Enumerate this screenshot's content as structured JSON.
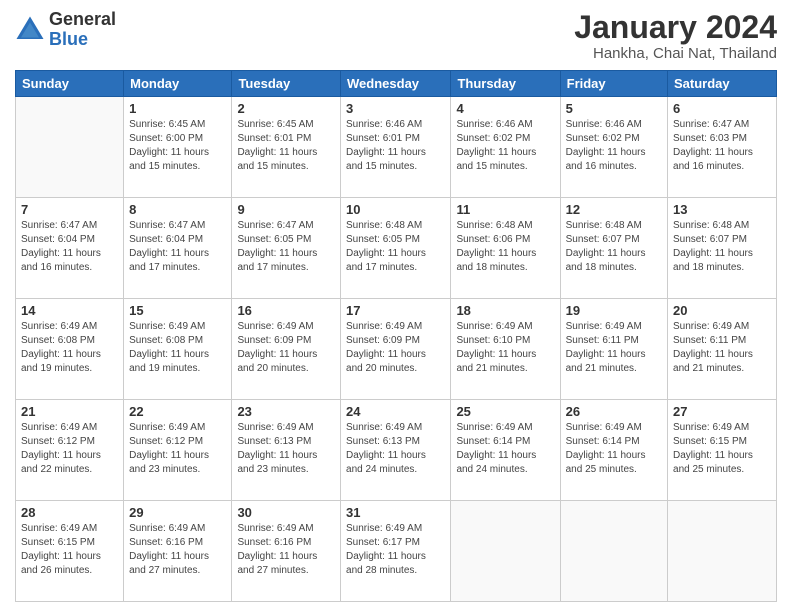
{
  "logo": {
    "general": "General",
    "blue": "Blue"
  },
  "header": {
    "title": "January 2024",
    "subtitle": "Hankha, Chai Nat, Thailand"
  },
  "days_of_week": [
    "Sunday",
    "Monday",
    "Tuesday",
    "Wednesday",
    "Thursday",
    "Friday",
    "Saturday"
  ],
  "weeks": [
    [
      {
        "day": "",
        "info": ""
      },
      {
        "day": "1",
        "info": "Sunrise: 6:45 AM\nSunset: 6:00 PM\nDaylight: 11 hours\nand 15 minutes."
      },
      {
        "day": "2",
        "info": "Sunrise: 6:45 AM\nSunset: 6:01 PM\nDaylight: 11 hours\nand 15 minutes."
      },
      {
        "day": "3",
        "info": "Sunrise: 6:46 AM\nSunset: 6:01 PM\nDaylight: 11 hours\nand 15 minutes."
      },
      {
        "day": "4",
        "info": "Sunrise: 6:46 AM\nSunset: 6:02 PM\nDaylight: 11 hours\nand 15 minutes."
      },
      {
        "day": "5",
        "info": "Sunrise: 6:46 AM\nSunset: 6:02 PM\nDaylight: 11 hours\nand 16 minutes."
      },
      {
        "day": "6",
        "info": "Sunrise: 6:47 AM\nSunset: 6:03 PM\nDaylight: 11 hours\nand 16 minutes."
      }
    ],
    [
      {
        "day": "7",
        "info": "Sunrise: 6:47 AM\nSunset: 6:04 PM\nDaylight: 11 hours\nand 16 minutes."
      },
      {
        "day": "8",
        "info": "Sunrise: 6:47 AM\nSunset: 6:04 PM\nDaylight: 11 hours\nand 17 minutes."
      },
      {
        "day": "9",
        "info": "Sunrise: 6:47 AM\nSunset: 6:05 PM\nDaylight: 11 hours\nand 17 minutes."
      },
      {
        "day": "10",
        "info": "Sunrise: 6:48 AM\nSunset: 6:05 PM\nDaylight: 11 hours\nand 17 minutes."
      },
      {
        "day": "11",
        "info": "Sunrise: 6:48 AM\nSunset: 6:06 PM\nDaylight: 11 hours\nand 18 minutes."
      },
      {
        "day": "12",
        "info": "Sunrise: 6:48 AM\nSunset: 6:07 PM\nDaylight: 11 hours\nand 18 minutes."
      },
      {
        "day": "13",
        "info": "Sunrise: 6:48 AM\nSunset: 6:07 PM\nDaylight: 11 hours\nand 18 minutes."
      }
    ],
    [
      {
        "day": "14",
        "info": "Sunrise: 6:49 AM\nSunset: 6:08 PM\nDaylight: 11 hours\nand 19 minutes."
      },
      {
        "day": "15",
        "info": "Sunrise: 6:49 AM\nSunset: 6:08 PM\nDaylight: 11 hours\nand 19 minutes."
      },
      {
        "day": "16",
        "info": "Sunrise: 6:49 AM\nSunset: 6:09 PM\nDaylight: 11 hours\nand 20 minutes."
      },
      {
        "day": "17",
        "info": "Sunrise: 6:49 AM\nSunset: 6:09 PM\nDaylight: 11 hours\nand 20 minutes."
      },
      {
        "day": "18",
        "info": "Sunrise: 6:49 AM\nSunset: 6:10 PM\nDaylight: 11 hours\nand 21 minutes."
      },
      {
        "day": "19",
        "info": "Sunrise: 6:49 AM\nSunset: 6:11 PM\nDaylight: 11 hours\nand 21 minutes."
      },
      {
        "day": "20",
        "info": "Sunrise: 6:49 AM\nSunset: 6:11 PM\nDaylight: 11 hours\nand 21 minutes."
      }
    ],
    [
      {
        "day": "21",
        "info": "Sunrise: 6:49 AM\nSunset: 6:12 PM\nDaylight: 11 hours\nand 22 minutes."
      },
      {
        "day": "22",
        "info": "Sunrise: 6:49 AM\nSunset: 6:12 PM\nDaylight: 11 hours\nand 23 minutes."
      },
      {
        "day": "23",
        "info": "Sunrise: 6:49 AM\nSunset: 6:13 PM\nDaylight: 11 hours\nand 23 minutes."
      },
      {
        "day": "24",
        "info": "Sunrise: 6:49 AM\nSunset: 6:13 PM\nDaylight: 11 hours\nand 24 minutes."
      },
      {
        "day": "25",
        "info": "Sunrise: 6:49 AM\nSunset: 6:14 PM\nDaylight: 11 hours\nand 24 minutes."
      },
      {
        "day": "26",
        "info": "Sunrise: 6:49 AM\nSunset: 6:14 PM\nDaylight: 11 hours\nand 25 minutes."
      },
      {
        "day": "27",
        "info": "Sunrise: 6:49 AM\nSunset: 6:15 PM\nDaylight: 11 hours\nand 25 minutes."
      }
    ],
    [
      {
        "day": "28",
        "info": "Sunrise: 6:49 AM\nSunset: 6:15 PM\nDaylight: 11 hours\nand 26 minutes."
      },
      {
        "day": "29",
        "info": "Sunrise: 6:49 AM\nSunset: 6:16 PM\nDaylight: 11 hours\nand 27 minutes."
      },
      {
        "day": "30",
        "info": "Sunrise: 6:49 AM\nSunset: 6:16 PM\nDaylight: 11 hours\nand 27 minutes."
      },
      {
        "day": "31",
        "info": "Sunrise: 6:49 AM\nSunset: 6:17 PM\nDaylight: 11 hours\nand 28 minutes."
      },
      {
        "day": "",
        "info": ""
      },
      {
        "day": "",
        "info": ""
      },
      {
        "day": "",
        "info": ""
      }
    ]
  ]
}
